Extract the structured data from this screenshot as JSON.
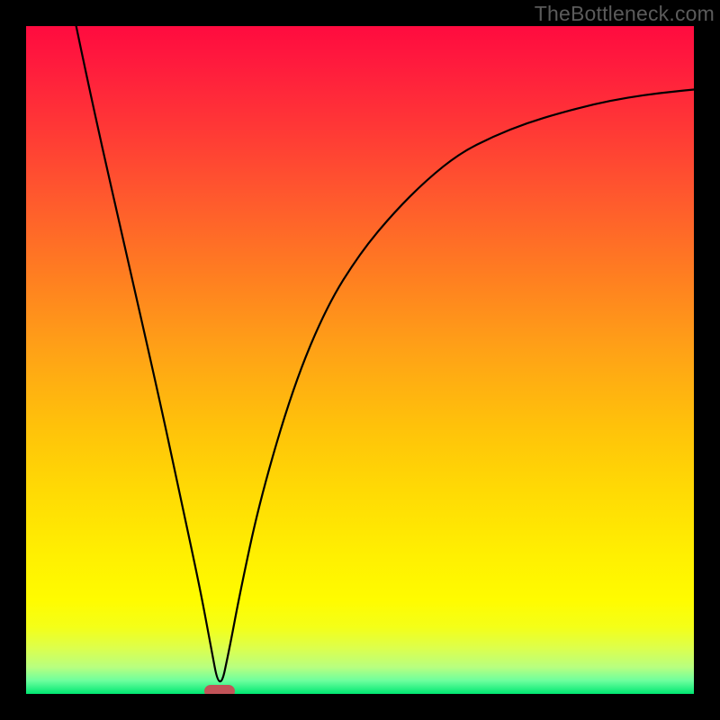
{
  "watermark": "TheBottleneck.com",
  "colors": {
    "frame_bg": "#000000",
    "marker": "#c25358",
    "curve": "#000000"
  },
  "chart_data": {
    "type": "line",
    "title": "",
    "xlabel": "",
    "ylabel": "",
    "xlim": [
      0,
      100
    ],
    "ylim": [
      0,
      100
    ],
    "grid": false,
    "curve": [
      {
        "x": 7.5,
        "y": 100
      },
      {
        "x": 10,
        "y": 88
      },
      {
        "x": 15,
        "y": 66
      },
      {
        "x": 20,
        "y": 44
      },
      {
        "x": 23,
        "y": 30
      },
      {
        "x": 26,
        "y": 16
      },
      {
        "x": 27.5,
        "y": 8
      },
      {
        "x": 29,
        "y": 0
      },
      {
        "x": 30.5,
        "y": 7
      },
      {
        "x": 32,
        "y": 15
      },
      {
        "x": 35,
        "y": 29
      },
      {
        "x": 40,
        "y": 46
      },
      {
        "x": 45,
        "y": 58
      },
      {
        "x": 50,
        "y": 66
      },
      {
        "x": 55,
        "y": 72
      },
      {
        "x": 60,
        "y": 77
      },
      {
        "x": 65,
        "y": 81
      },
      {
        "x": 70,
        "y": 83.5
      },
      {
        "x": 75,
        "y": 85.5
      },
      {
        "x": 80,
        "y": 87
      },
      {
        "x": 85,
        "y": 88.3
      },
      {
        "x": 90,
        "y": 89.3
      },
      {
        "x": 95,
        "y": 90
      },
      {
        "x": 100,
        "y": 90.5
      }
    ],
    "marker": {
      "x": 29,
      "y": 0
    },
    "gradient_stops": [
      {
        "pct": 0,
        "color": "#ff0b3f"
      },
      {
        "pct": 50,
        "color": "#ffa316"
      },
      {
        "pct": 86,
        "color": "#fffc00"
      },
      {
        "pct": 100,
        "color": "#00e771"
      }
    ]
  }
}
